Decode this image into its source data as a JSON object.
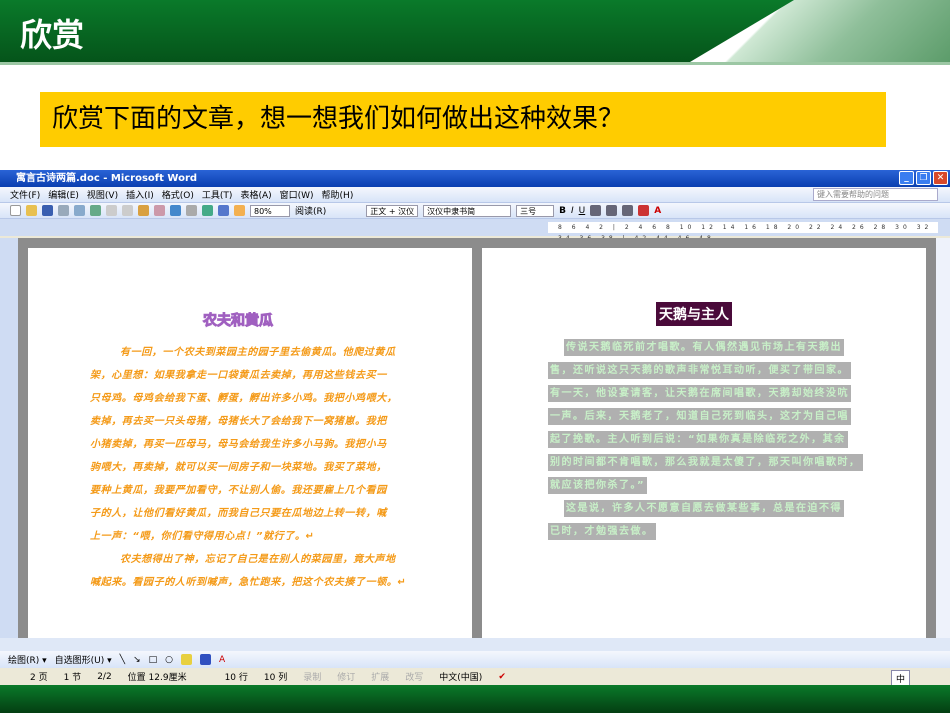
{
  "slide": {
    "title": "欣赏",
    "question": "欣赏下面的文章，想一想我们如何做出这种效果？"
  },
  "window": {
    "title": "寓言古诗两篇.doc - Microsoft Word",
    "buttons": [
      "_",
      "❐",
      "✕"
    ]
  },
  "menu": [
    "文件(F)",
    "编辑(E)",
    "视图(V)",
    "插入(I)",
    "格式(O)",
    "工具(T)",
    "表格(A)",
    "窗口(W)",
    "帮助(H)"
  ],
  "help_placeholder": "键入需要帮助的问题",
  "toolbar": {
    "zoom": "80%",
    "read": "阅读(R)",
    "style": "正文 + 汉仪",
    "font": "汉仪中隶书简",
    "size": "三号",
    "bold": "B",
    "italic": "I",
    "underline": "U",
    "font_color": "A"
  },
  "ruler": {
    "ticks": "8 6 4 2 | 2 4 6 8 10 12 14 16 18 20 22 24 26 28 30 32 34 36 38 | 42 44 46 48"
  },
  "page1": {
    "title": "农夫和黄瓜",
    "lines": [
      "有一回，一个农夫到菜园主的园子里去偷黄瓜。他爬过黄瓜",
      "架，心里想：如果我拿走一口袋黄瓜去卖掉，再用这些钱去买一",
      "只母鸡。母鸡会给我下蛋、孵蛋，孵出许多小鸡。我把小鸡喂大，",
      "卖掉，再去买一只头母猪，母猪长大了会给我下一窝猪崽。我把",
      "小猪卖掉，再买一匹母马，母马会给我生许多小马驹。我把小马",
      "驹喂大，再卖掉，就可以买一间房子和一块菜地。我买了菜地，",
      "要种上黄瓜，我要严加看守，不让别人偷。我还要雇上几个看园",
      "子的人，让他们看好黄瓜，而我自己只要在瓜地边上转一转，喊",
      "上一声：“喂，你们看守得用心点！”就行了。↵",
      "农夫想得出了神，忘记了自己是在别人的菜园里，竟大声地",
      "喊起来。看园子的人听到喊声，急忙跑来，把这个农夫揍了一顿。↵"
    ]
  },
  "page2": {
    "title": "天鹅与主人",
    "lines": [
      "传说天鹅临死前才唱歌。有人偶然遇见市场上有天鹅出",
      "售，还听说这只天鹅的歌声非常悦耳动听，便买了带回家。",
      "有一天，他设宴请客，让天鹅在席间唱歌，天鹅却始终没吭",
      "一声。后来，天鹅老了，知道自己死到临头，这才为自己唱",
      "起了挽歌。主人听到后说：“如果你真是除临死之外，其余",
      "别的时间都不肯唱歌，那么我就是太傻了，那天叫你唱歌时，",
      "就应该把你杀了。”",
      "这是说，许多人不愿意自愿去做某些事，总是在迫不得",
      "已时，才勉强去做。"
    ]
  },
  "drawbar": {
    "draw": "绘图(R) ▾",
    "autoshape": "自选图形(U) ▾"
  },
  "status": {
    "page": "2 页",
    "section": "1 节",
    "pages": "2/2",
    "position": "位置 12.9厘米",
    "line": "10 行",
    "col": "10 列",
    "rec": "录制",
    "trk": "修订",
    "ext": "扩展",
    "ovr": "改写",
    "lang": "中文(中国)"
  },
  "ime": "中"
}
